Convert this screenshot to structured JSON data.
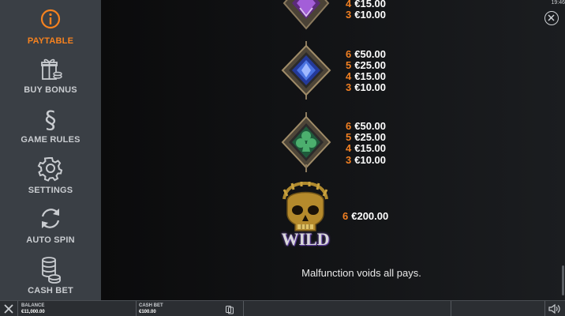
{
  "sidebar": {
    "items": [
      {
        "label": "PAYTABLE",
        "icon": "info-icon",
        "active": true
      },
      {
        "label": "BUY BONUS",
        "icon": "gift-icon",
        "active": false
      },
      {
        "label": "GAME RULES",
        "icon": "section-icon",
        "active": false
      },
      {
        "label": "SETTINGS",
        "icon": "gear-icon",
        "active": false
      },
      {
        "label": "AUTO SPIN",
        "icon": "refresh-icon",
        "active": false
      },
      {
        "label": "CASH BET",
        "icon": "coins-icon",
        "active": false
      }
    ]
  },
  "status": {
    "clock": "19:46"
  },
  "paytable": {
    "purple_symbol": {
      "icon": "purple-gem-icon",
      "payouts": [
        {
          "count": "4",
          "amount": "€15.00"
        },
        {
          "count": "3",
          "amount": "€10.00"
        }
      ]
    },
    "blue_symbol": {
      "icon": "blue-diamond-gem-icon",
      "payouts": [
        {
          "count": "6",
          "amount": "€50.00"
        },
        {
          "count": "5",
          "amount": "€25.00"
        },
        {
          "count": "4",
          "amount": "€15.00"
        },
        {
          "count": "3",
          "amount": "€10.00"
        }
      ]
    },
    "green_symbol": {
      "icon": "green-club-gem-icon",
      "payouts": [
        {
          "count": "6",
          "amount": "€50.00"
        },
        {
          "count": "5",
          "amount": "€25.00"
        },
        {
          "count": "4",
          "amount": "€15.00"
        },
        {
          "count": "3",
          "amount": "€10.00"
        }
      ]
    },
    "wild_symbol": {
      "icon": "golden-skull-icon",
      "text": "WILD",
      "payouts": [
        {
          "count": "6",
          "amount": "€200.00"
        }
      ]
    },
    "footer": "Malfunction voids all pays."
  },
  "bottombar": {
    "balance_label": "BALANCE",
    "balance_value": "€11,000.00",
    "cashbet_label": "CASH BET",
    "cashbet_value": "€100.00"
  },
  "colors": {
    "accent": "#f6821f",
    "sidebar_bg": "#3a3f45",
    "count_color": "#f07f22"
  }
}
